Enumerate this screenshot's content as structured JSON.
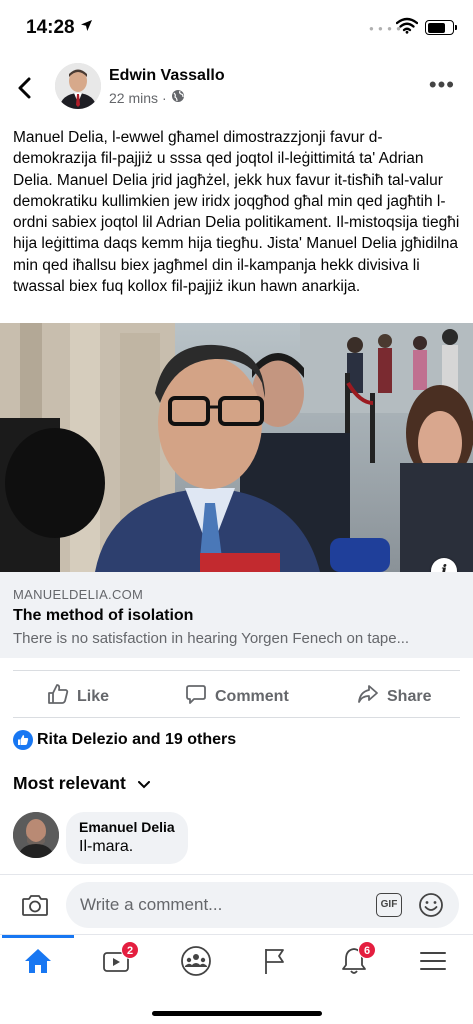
{
  "status_bar": {
    "time": "14:28",
    "location_arrow": "location-arrow-icon"
  },
  "post": {
    "author": "Edwin Vassallo",
    "time_ago": "22 mins",
    "separator": "·",
    "audience_icon": "globe-icon",
    "text": "Manuel Delia, l-ewwel għamel dimostrazzjonji favur d-demokrazija fil-pajjiż u sssa qed joqtol il-leġittimitá ta' Adrian Delia. Manuel Delia jrid jagħżel, jekk hux favur it-tisħiħ tal-valur demokratiku kullimkien jew iridx joqgħod għal min qed jagħtih l-ordni sabiex joqtol lil Adrian Delia politikament. Il-mistoqsija tiegħi hija leġittima daqs kemm hija tiegħu. Jista' Manuel Delia jgħidilna min qed iħallsu biex jagħmel din il-kampanja hekk divisiva li twassal biex fuq kollox fil-pajjiż ikun hawn anarkija."
  },
  "link_preview": {
    "domain": "MANUELDELIA.COM",
    "title": "The method of isolation",
    "description": "There is no satisfaction in hearing Yorgen Fenech on tape..."
  },
  "actions": {
    "like": "Like",
    "comment": "Comment",
    "share": "Share"
  },
  "reactions": {
    "text": "Rita Delezio and 19 others"
  },
  "sort": {
    "label": "Most relevant"
  },
  "comments": [
    {
      "author": "Emanuel Delia",
      "text": "Il-mara."
    }
  ],
  "composer": {
    "placeholder": "Write a comment...",
    "gif_label": "GIF"
  },
  "tabbar": {
    "items": [
      {
        "name": "home",
        "badge": ""
      },
      {
        "name": "watch",
        "badge": "2"
      },
      {
        "name": "groups",
        "badge": ""
      },
      {
        "name": "pages",
        "badge": ""
      },
      {
        "name": "notifications",
        "badge": "6"
      },
      {
        "name": "menu",
        "badge": ""
      }
    ]
  },
  "colors": {
    "accent": "#1877f2",
    "badge": "#e41e3f",
    "secondary_text": "#65676b"
  }
}
